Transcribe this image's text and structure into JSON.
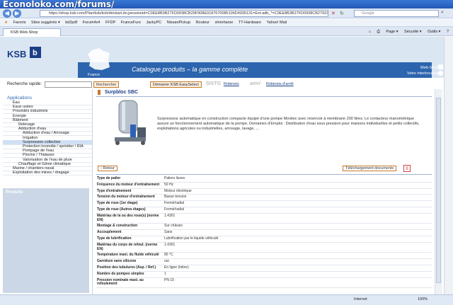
{
  "watermark": "Econoloko.com/forums/",
  "browser": {
    "url": "https://shop.ksb.com/Plan/ksb/kcb/de/start.do;jsessionid=C0EE8B3B27FD0938CB29F908E0187670085106D4935131=Ext-adb_*=C0EE8B3B27FD0938CB27923679=exsion",
    "search_placeholder": "Google",
    "favorites_label": "Favoris",
    "favorites": [
      "Sites suggérés ▾",
      "bd2pdf",
      "Forum4x4",
      "FFDP",
      "FranceFurs",
      "JackyPC",
      "NissanPickup",
      "Routeur",
      "shireharse",
      "TT-Hardware",
      "Yahoo! Mail"
    ],
    "tab_title": "KSB Web-Shop",
    "tools": [
      "Page ▾",
      "Sécurité ▾",
      "Outils ▾",
      "?"
    ],
    "status_zone": "Internet",
    "zoom": "100%"
  },
  "header": {
    "logo_text": "KSB",
    "country": "France",
    "catalogue_title": "Catalogue produits  –  la gamme complète",
    "webshop_label": "Web-Shop",
    "contact_label": "Votre interlocuteur"
  },
  "search": {
    "label": "Recherche rapide:",
    "value": "",
    "button": "Rechercher",
    "easyselect_button": "Démarrer KSB EasySelect",
    "brand1": "SISTO",
    "brand1_link": "Robinets",
    "brand2": "amri",
    "brand2_link": "Robinets d'arrêt"
  },
  "sidebar": {
    "heading": "Applications",
    "items": [
      {
        "label": "Eau",
        "indent": 0,
        "selected": false
      },
      {
        "label": "Eaux usées",
        "indent": 0,
        "selected": false
      },
      {
        "label": "Procédés industriels",
        "indent": 0,
        "selected": false
      },
      {
        "label": "Energie",
        "indent": 0,
        "selected": false
      },
      {
        "label": "Bâtiment",
        "indent": 0,
        "selected": false
      },
      {
        "label": "Relevage",
        "indent": 1,
        "selected": false
      },
      {
        "label": "Adduction d'eau",
        "indent": 1,
        "selected": false
      },
      {
        "label": "Adduction d'eau / Arrosage",
        "indent": 2,
        "selected": false
      },
      {
        "label": "Irrigation",
        "indent": 2,
        "selected": false
      },
      {
        "label": "Surpression collective",
        "indent": 2,
        "selected": true
      },
      {
        "label": "Protection incendie / sprinkler / RIA",
        "indent": 2,
        "selected": false
      },
      {
        "label": "Pompage de l'eau",
        "indent": 2,
        "selected": false
      },
      {
        "label": "Piscine / Thalasso",
        "indent": 2,
        "selected": false
      },
      {
        "label": "Valorisation de l'eau de pluie",
        "indent": 2,
        "selected": false
      },
      {
        "label": "Chauffage et Génie climatique",
        "indent": 1,
        "selected": false
      },
      {
        "label": "Marine / chantiers naval",
        "indent": 0,
        "selected": false
      },
      {
        "label": "Exploitation des mines / dragage",
        "indent": 0,
        "selected": false
      }
    ],
    "products_label": "Produits"
  },
  "product": {
    "title": "Surpbloc SBC",
    "description": "Surpresseur automatique en construction compacte équipé d'une pompe Movitec avec réservoir à membrane 200 litres. Le contacteur manométrique assure un fonctionnement automatique de la pompe. Domaines d'Emploi : Distribution d'eau sous pression pour maisons individuelles et petits collectifs, exploitations agricoles ou industrielles, arrosage, lavage, ...",
    "back_button": "‹ Retour",
    "download_button": "Téléchargement documents",
    "specs": [
      {
        "k": "Type de palier",
        "v": "Paliers lisses"
      },
      {
        "k": "Fréquence du moteur d'entraînement",
        "v": "50 Hz"
      },
      {
        "k": "Type d'entraînement",
        "v": "Moteur électrique"
      },
      {
        "k": "Tension du moteur d'entraînement",
        "v": "Basse tension"
      },
      {
        "k": "Type de roue (1er étage)",
        "v": "Fermé/radial"
      },
      {
        "k": "Type de roue (Autres étages)",
        "v": "Fermé/radial"
      },
      {
        "k": "Matériau de la ou des roue(s) (norme EN)",
        "v": "1.4301"
      },
      {
        "k": "Montage & construction",
        "v": "Sur châssis"
      },
      {
        "k": "Accouplement",
        "v": "Sans"
      },
      {
        "k": "Type de lubrification",
        "v": "Lubrification par le liquide véhiculé"
      },
      {
        "k": "Matériau du corps de refoul. (norme EN)",
        "v": "1.4301"
      },
      {
        "k": "Température maxi. du fluide véhiculé",
        "v": "80 °C"
      },
      {
        "k": "Garniture sans silicone",
        "v": "oui"
      },
      {
        "k": "Position des tubulures (Asp. / Ref.)",
        "v": "En ligne (Inline)"
      },
      {
        "k": "Nombre de pompes simples",
        "v": "1"
      },
      {
        "k": "Pression nominale maxi. au refoulement",
        "v": "PN 10"
      }
    ]
  }
}
